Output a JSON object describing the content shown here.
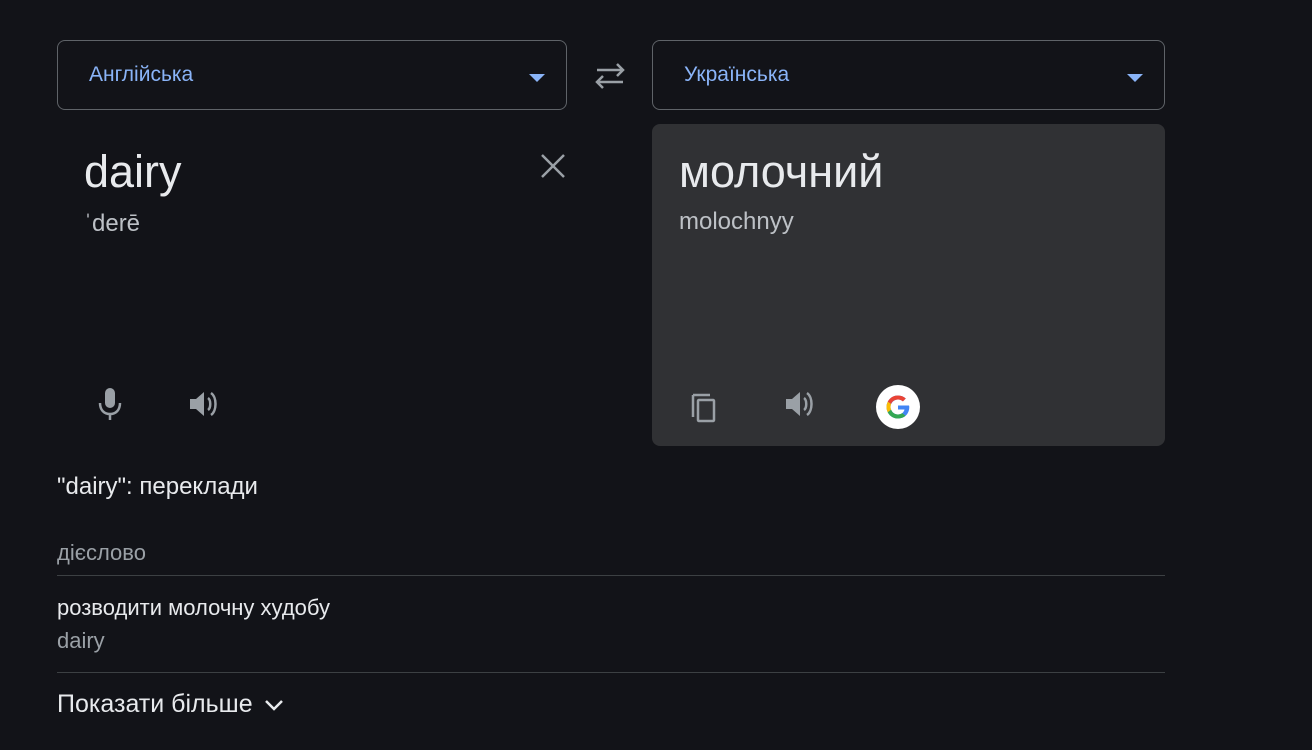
{
  "source_language": {
    "label": "Англійська"
  },
  "target_language": {
    "label": "Українська"
  },
  "source": {
    "text": "dairy",
    "phonetic": "ˈderē"
  },
  "target": {
    "text": "молочний",
    "transliteration": "molochnyy"
  },
  "dictionary": {
    "title": "\"dairy\": переклади",
    "part_of_speech": "дієслово",
    "entries": [
      {
        "word": "розводити молочну худобу",
        "reverse": "dairy"
      }
    ],
    "show_more_label": "Показати більше"
  },
  "icons": {
    "swap": "swap-arrows-icon",
    "clear": "close-icon",
    "mic": "microphone-icon",
    "speaker": "speaker-icon",
    "copy": "copy-icon",
    "google": "google-g-icon",
    "chevron": "chevron-down-icon"
  },
  "colors": {
    "background": "#121318",
    "panel": "#303134",
    "accent": "#8ab4f8",
    "text": "#e8eaed",
    "muted": "#9aa0a6"
  }
}
